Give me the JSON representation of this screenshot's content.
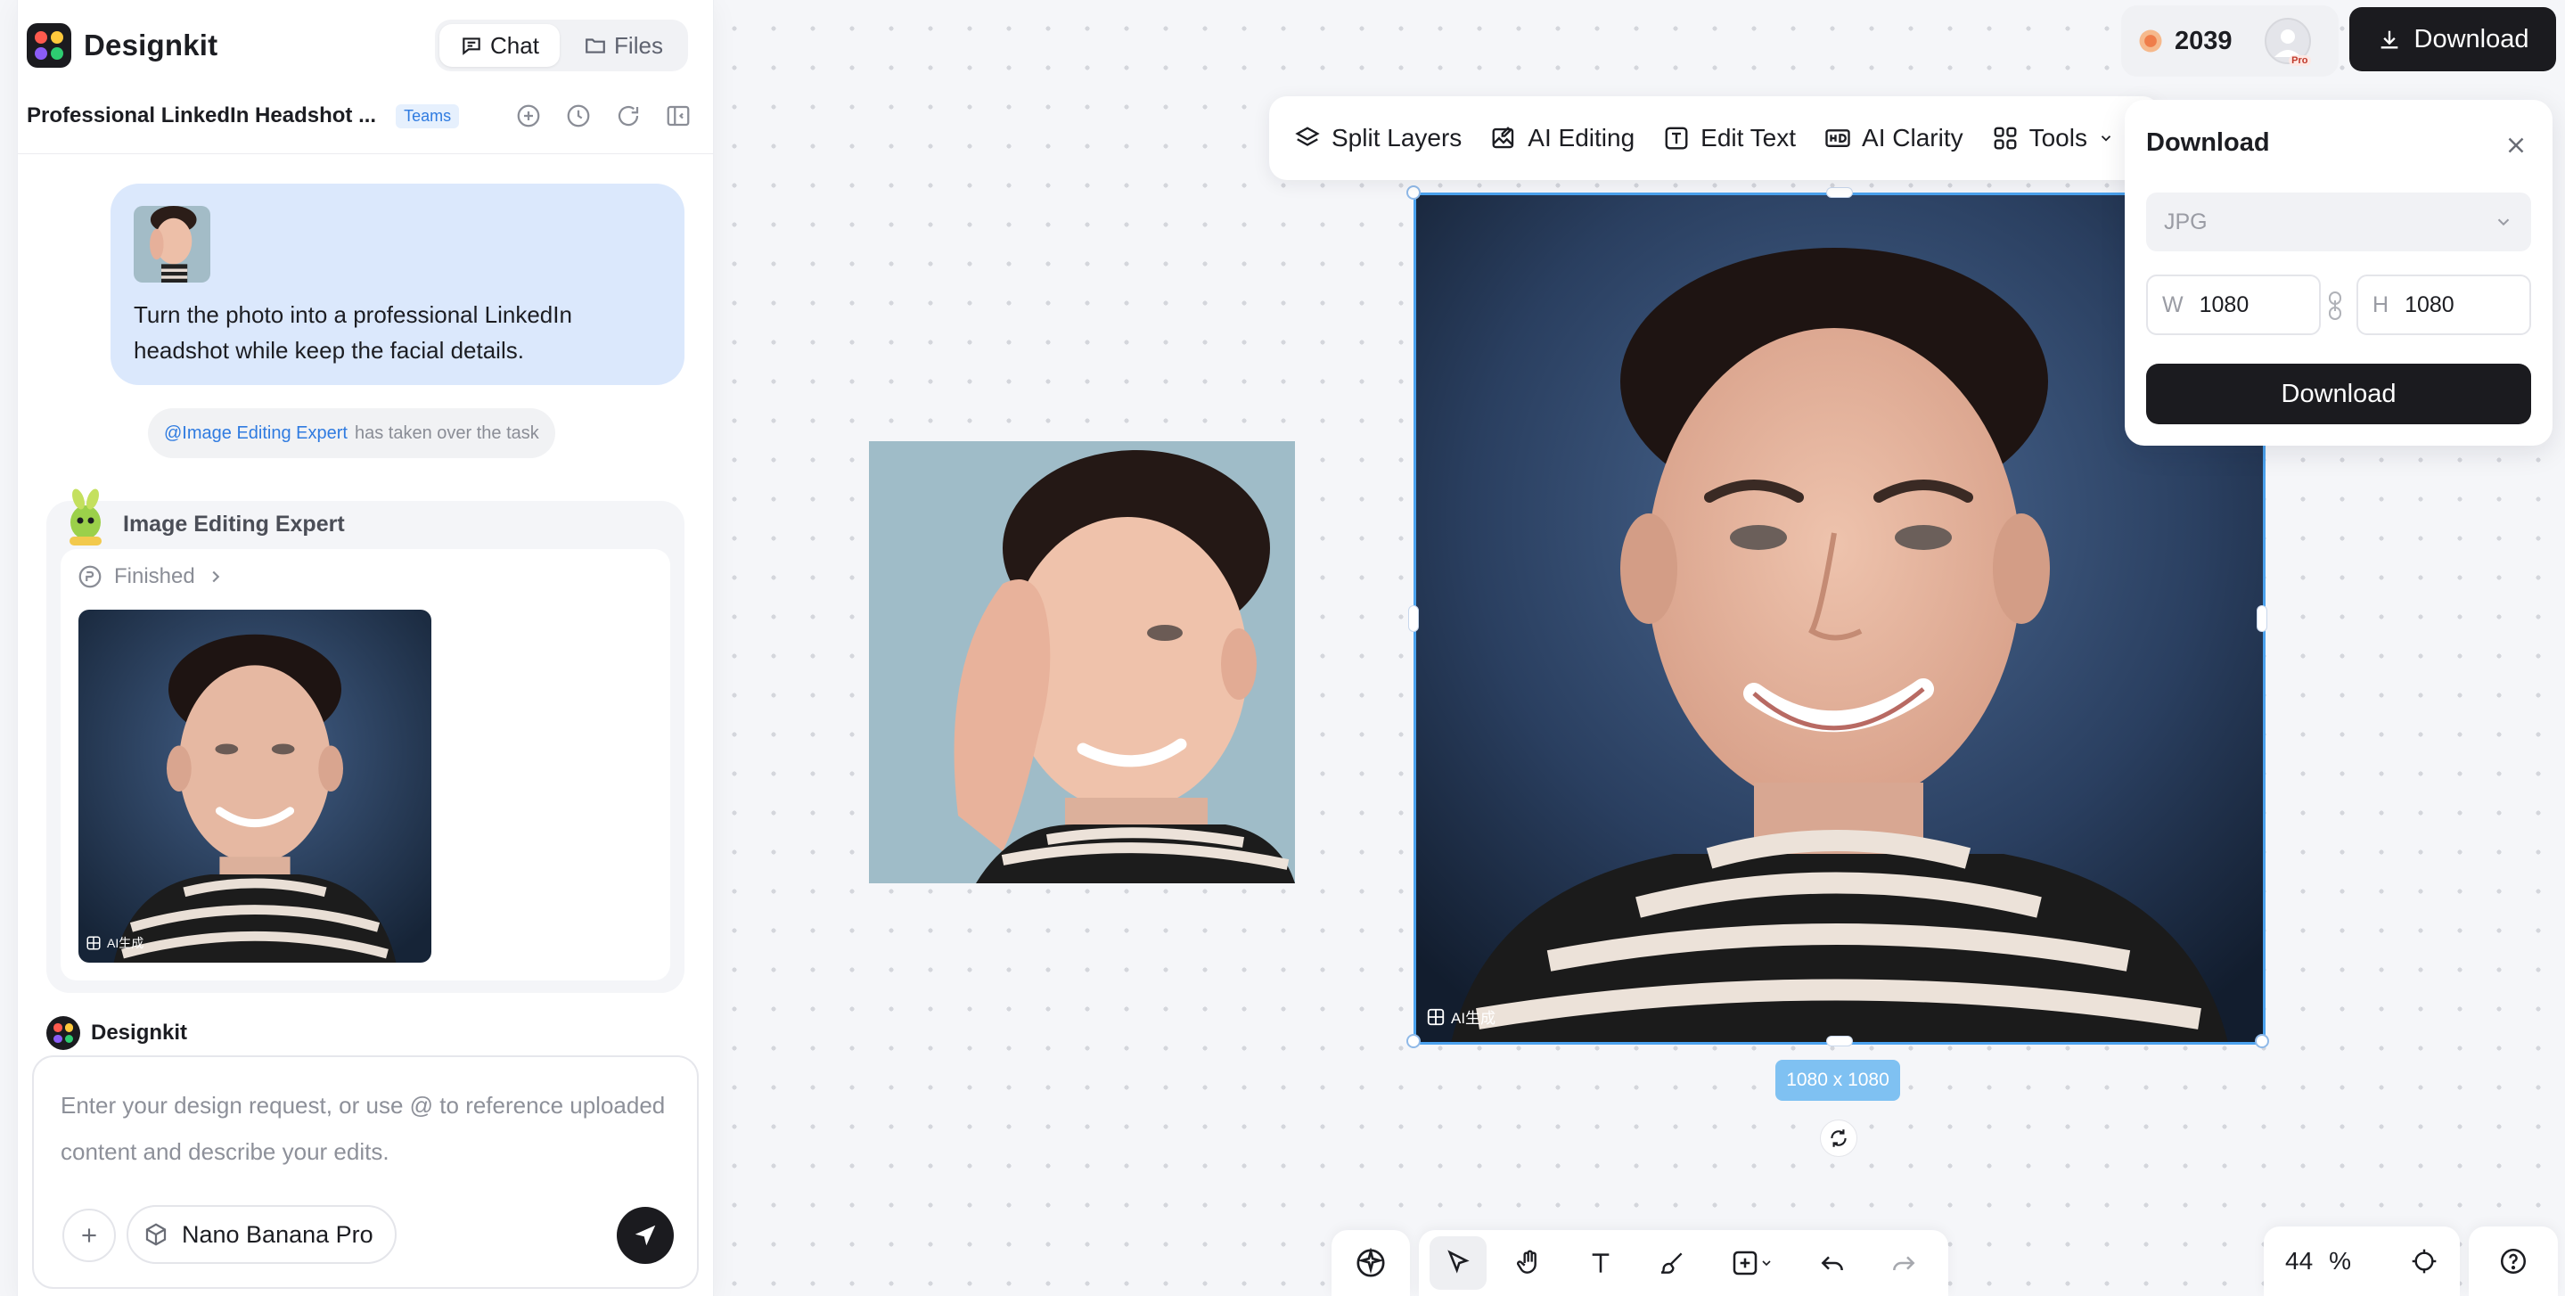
{
  "app": {
    "brand": "Designkit",
    "tabs": [
      {
        "label": "Chat",
        "icon": "chat-bubble-icon",
        "active": true
      },
      {
        "label": "Files",
        "icon": "folder-icon",
        "active": false
      }
    ],
    "project_title": "Professional LinkedIn Headshot ...",
    "project_badge": "Teams"
  },
  "chat": {
    "user_message": "Turn the photo into a professional LinkedIn headshot while keep the facial details.",
    "takeover_mention": "@Image Editing Expert",
    "takeover_text": "has taken over the task",
    "expert_name": "Image Editing Expert",
    "status": "Finished",
    "ai_tag": "AI生成",
    "designkit_label": "Designkit",
    "composer_placeholder": "Enter your design request, or use @ to reference uploaded content and describe your edits.",
    "model": "Nano Banana Pro"
  },
  "toolbar": {
    "items": [
      {
        "label": "Split Layers",
        "icon": "layers-icon"
      },
      {
        "label": "AI Editing",
        "icon": "ai-edit-image-icon"
      },
      {
        "label": "Edit Text",
        "icon": "edit-text-icon"
      },
      {
        "label": "AI Clarity",
        "icon": "hd-icon"
      },
      {
        "label": "Tools",
        "icon": "grid-tools-icon"
      }
    ]
  },
  "topbar": {
    "credits": "2039",
    "pro_badge": "Pro",
    "download_label": "Download"
  },
  "download_panel": {
    "title": "Download",
    "format": "JPG",
    "width_label": "W",
    "width": "1080",
    "height_label": "H",
    "height": "1080",
    "button": "Download"
  },
  "canvas": {
    "dimensions": "1080 x 1080",
    "ai_tag": "AI生成"
  },
  "zoom": {
    "value": "44",
    "unit": "%"
  },
  "colors": {
    "accent": "#2f7be0",
    "selection": "#4ba2ee",
    "user_bubble": "#dbe8fc",
    "dark_button": "#1b1b1f"
  }
}
